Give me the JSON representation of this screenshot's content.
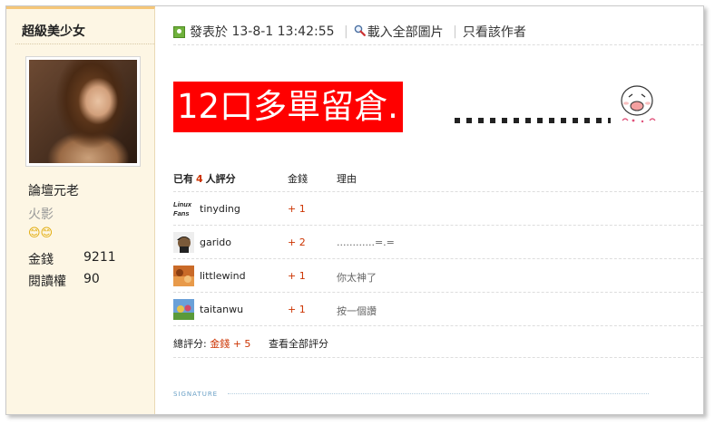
{
  "sidebar": {
    "username": "超級美少女",
    "rank": "論壇元老",
    "star_title": "火影",
    "emoji": "😊😊",
    "stats": [
      {
        "label": "金錢",
        "value": "9211"
      },
      {
        "label": "閱讀權",
        "value": "90"
      }
    ]
  },
  "post": {
    "posted_label": "發表於",
    "posted_time": "13-8-1 13:42:55",
    "load_images": "載入全部圖片",
    "only_author": "只看該作者",
    "title": "12口多單留倉."
  },
  "rating": {
    "header_prefix": "已有",
    "count": "4",
    "header_suffix": "人評分",
    "col_money": "金錢",
    "col_reason": "理由",
    "rows": [
      {
        "user": "tinyding",
        "score": "+ 1",
        "reason": ""
      },
      {
        "user": "garido",
        "score": "+ 2",
        "reason": "............=.="
      },
      {
        "user": "littlewind",
        "score": "+ 1",
        "reason": "你太神了"
      },
      {
        "user": "taitanwu",
        "score": "+ 1",
        "reason": "按一個讚"
      }
    ],
    "total_label": "總評分:",
    "total_value": "金錢 + 5",
    "view_all": "查看全部評分",
    "avatar_text_linux": "Linux",
    "avatar_text_fans": "Fans"
  },
  "signature_label": "SIGNATURE"
}
